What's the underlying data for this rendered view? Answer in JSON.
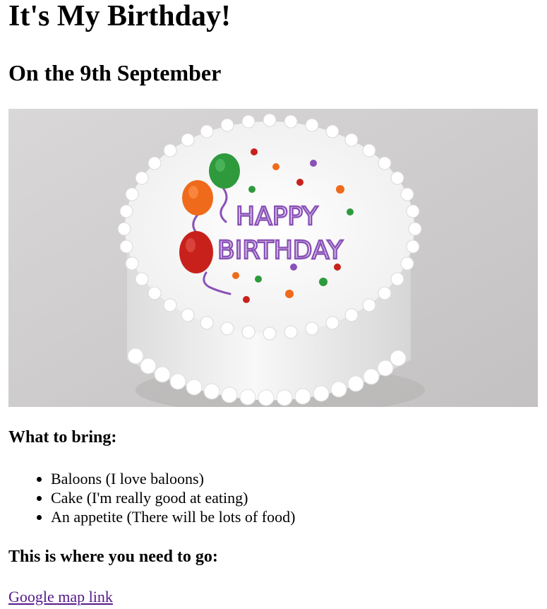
{
  "page": {
    "title": "It's My Birthday!",
    "subtitle": "On the 9th September"
  },
  "image": {
    "subject": "white birthday cake with balloons and sprinkles",
    "inscription_line1": "HAPPY",
    "inscription_line2": "BIRTHDAY"
  },
  "bring": {
    "heading": "What to bring:",
    "items": [
      "Baloons (I love baloons)",
      "Cake (I'm really good at eating)",
      "An appetite (There will be lots of food)"
    ]
  },
  "location": {
    "heading": "This is where you need to go:",
    "link_text": "Google map link"
  },
  "colors": {
    "text": "#000000",
    "visited_link": "#551a8b",
    "background": "#ffffff",
    "balloon_green": "#2e9a3c",
    "balloon_orange": "#ef6a1a",
    "balloon_red": "#c8211c",
    "lettering_purple": "#8a52b8"
  }
}
